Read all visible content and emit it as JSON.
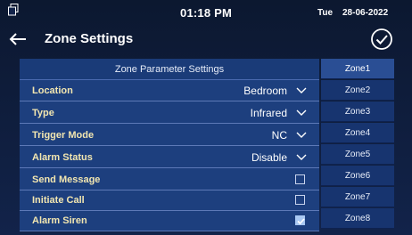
{
  "status": {
    "time": "01:18 PM",
    "day": "Tue",
    "date": "28-06-2022"
  },
  "header": {
    "title": "Zone Settings"
  },
  "panel": {
    "title": "Zone Parameter Settings",
    "rows": [
      {
        "label": "Location",
        "value": "Bedroom"
      },
      {
        "label": "Type",
        "value": "Infrared"
      },
      {
        "label": "Trigger Mode",
        "value": "NC"
      },
      {
        "label": "Alarm Status",
        "value": "Disable"
      },
      {
        "label": "Send Message",
        "checked": false
      },
      {
        "label": "Initiate Call",
        "checked": false
      },
      {
        "label": "Alarm Siren",
        "checked": true
      }
    ]
  },
  "zones": [
    "Zone1",
    "Zone2",
    "Zone3",
    "Zone4",
    "Zone5",
    "Zone6",
    "Zone7",
    "Zone8"
  ],
  "selected_zone": "Zone1",
  "colors": {
    "label": "#f2e6b0",
    "panel": "#1d3f7e",
    "zone_active": "#2a4e94"
  }
}
